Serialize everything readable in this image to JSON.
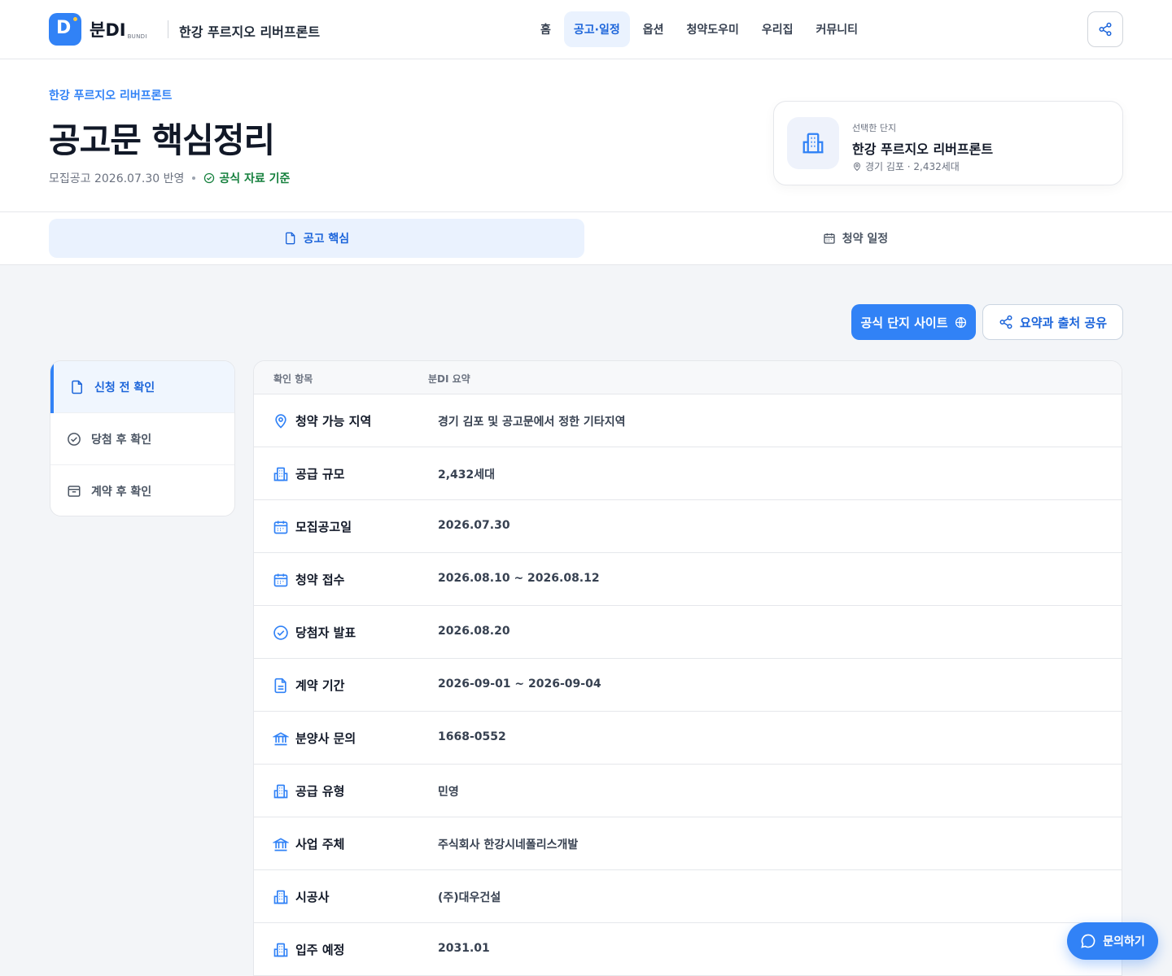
{
  "header": {
    "logo_mark": "D",
    "logo_text": "분DI",
    "logo_sub": "BUNDI",
    "complex_name": "한강 푸르지오 리버프론트",
    "nav": [
      "홈",
      "공고·일정",
      "옵션",
      "청약도우미",
      "우리집",
      "커뮤니티"
    ],
    "active_nav_index": 1,
    "share_icon": "share-icon"
  },
  "hero": {
    "eyebrow": "한강 푸르지오 리버프론트",
    "title": "공고문 핵심정리",
    "meta_text": "모집공고 2026.07.30 반영",
    "official_label": "공식 자료 기준",
    "selected_card": {
      "label": "선택한 단지",
      "name": "한강 푸르지오 리버프론트",
      "location": "경기 김포 · 2,432세대"
    }
  },
  "tabs": [
    {
      "label": "공고 핵심",
      "icon": "document-icon",
      "active": true
    },
    {
      "label": "청약 일정",
      "icon": "calendar-icon",
      "active": false
    }
  ],
  "actions": {
    "primary": "공식 단지 사이트",
    "secondary": "요약과 출처 공유"
  },
  "sidenav": [
    {
      "label": "신청 전 확인",
      "icon": "document-icon",
      "active": true
    },
    {
      "label": "당첨 후 확인",
      "icon": "check-circle-icon",
      "active": false
    },
    {
      "label": "계약 후 확인",
      "icon": "archive-icon",
      "active": false
    }
  ],
  "table": {
    "headers": [
      "확인 항목",
      "분DI 요약"
    ],
    "rows": [
      {
        "label": "청약 가능 지역",
        "value": "경기 김포 및 공고문에서 정한 기타지역",
        "icon": "location-pin-icon"
      },
      {
        "label": "공급 규모",
        "value": "2,432세대",
        "icon": "building-icon"
      },
      {
        "label": "모집공고일",
        "value": "2026.07.30",
        "icon": "calendar-icon"
      },
      {
        "label": "청약 접수",
        "value": "2026.08.10 ~ 2026.08.12",
        "icon": "calendar-icon"
      },
      {
        "label": "당첨자 발표",
        "value": "2026.08.20",
        "icon": "check-circle-icon"
      },
      {
        "label": "계약 기간",
        "value": "2026-09-01 ~ 2026-09-04",
        "icon": "document-text-icon"
      },
      {
        "label": "분양사 문의",
        "value": "1668-0552",
        "icon": "bank-icon"
      },
      {
        "label": "공급 유형",
        "value": "민영",
        "icon": "building-icon"
      },
      {
        "label": "사업 주체",
        "value": "주식회사 한강시네폴리스개발",
        "icon": "bank-icon"
      },
      {
        "label": "시공사",
        "value": "(주)대우건설",
        "icon": "building-icon"
      },
      {
        "label": "입주 예정",
        "value": "2031.01",
        "icon": "building-icon"
      }
    ]
  },
  "fab": {
    "label": "문의하기",
    "icon": "chat-icon"
  },
  "colors": {
    "accent": "#3182f6",
    "accent_dark": "#1b64da",
    "success": "#15803d"
  }
}
